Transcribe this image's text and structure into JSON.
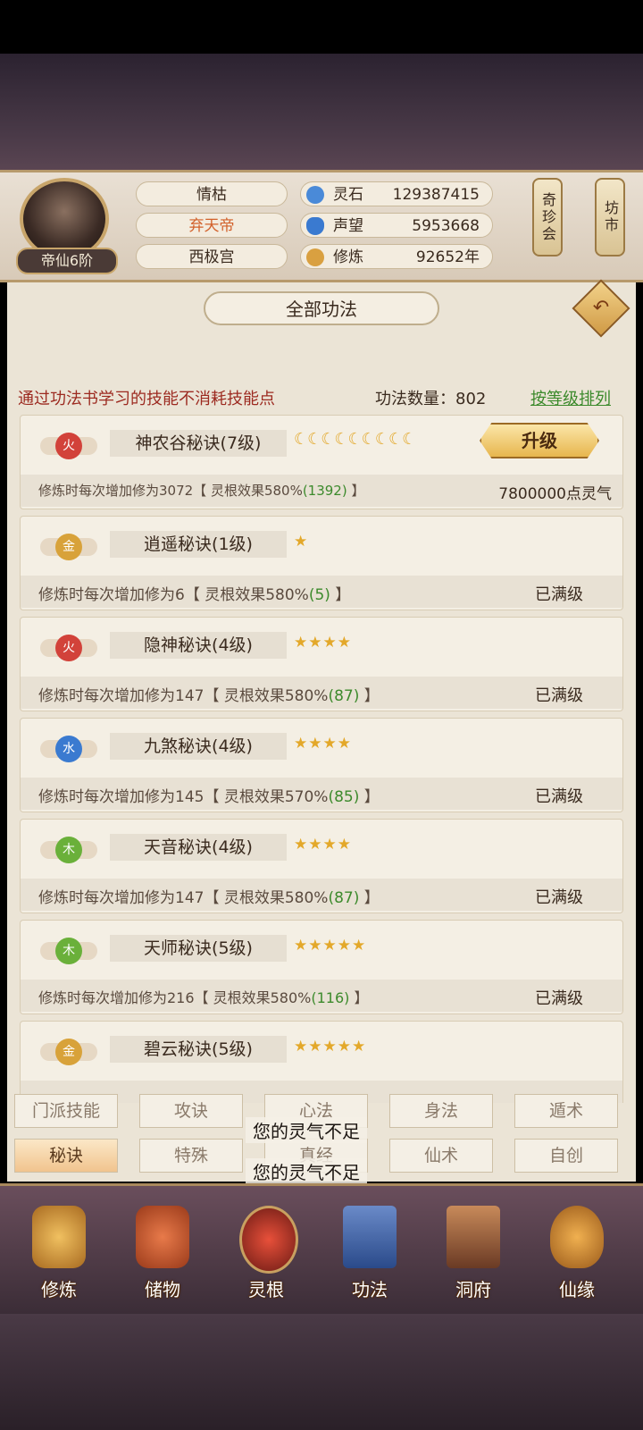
{
  "player": {
    "rank": "帝仙6阶",
    "name": "情枯",
    "title": "弃天帝",
    "sect": "西极宫",
    "resources": [
      {
        "label": "灵石",
        "value": "129387415",
        "icon": "spirit-stone-icon",
        "color": "#4a8ad8"
      },
      {
        "label": "声望",
        "value": "5953668",
        "icon": "prestige-crystal-icon",
        "color": "#3a7ad0"
      },
      {
        "label": "修炼",
        "value": "92652年",
        "icon": "meditation-icon",
        "color": "#d9a040"
      }
    ]
  },
  "side_buttons": {
    "treasure": "奇珍会",
    "market": "坊市"
  },
  "panel": {
    "title": "全部功法",
    "note": "通过功法书学习的技能不消耗技能点",
    "count_label": "功法数量：802",
    "sort_label": "按等级排列"
  },
  "skills": [
    {
      "element": "火",
      "element_color": "#d2423a",
      "name": "神农谷秘诀(7级)",
      "rating": "☾☾☾☾☾☾☾☾☾",
      "desc": "修炼时每次增加修为3072【 灵根效果580%",
      "bonus": "(1392)",
      "desc_end": " 】",
      "status": "7800000点灵气",
      "action": "升级"
    },
    {
      "element": "金",
      "element_color": "#d8a23a",
      "name": "逍遥秘诀(1级)",
      "rating": "★",
      "desc": "修炼时每次增加修为6【 灵根效果580%",
      "bonus": "(5)",
      "desc_end": " 】",
      "status": "已满级"
    },
    {
      "element": "火",
      "element_color": "#d2423a",
      "name": "隐神秘诀(4级)",
      "rating": "★★★★",
      "desc": "修炼时每次增加修为147【 灵根效果580%",
      "bonus": "(87)",
      "desc_end": " 】",
      "status": "已满级"
    },
    {
      "element": "水",
      "element_color": "#3a7ad0",
      "name": "九煞秘诀(4级)",
      "rating": "★★★★",
      "desc": "修炼时每次增加修为145【 灵根效果570%",
      "bonus": "(85)",
      "desc_end": " 】",
      "status": "已满级"
    },
    {
      "element": "木",
      "element_color": "#6ab03a",
      "name": "天音秘诀(4级)",
      "rating": "★★★★",
      "desc": "修炼时每次增加修为147【 灵根效果580%",
      "bonus": "(87)",
      "desc_end": " 】",
      "status": "已满级"
    },
    {
      "element": "木",
      "element_color": "#6ab03a",
      "name": "天师秘诀(5级)",
      "rating": "★★★★★",
      "desc": "修炼时每次增加修为216【 灵根效果580%",
      "bonus": "(116)",
      "desc_end": " 】",
      "status": "已满级"
    },
    {
      "element": "金",
      "element_color": "#d8a23a",
      "name": "碧云秘诀(5级)",
      "rating": "★★★★★",
      "desc": "",
      "bonus": "",
      "desc_end": "",
      "status": ""
    }
  ],
  "tabs_row1": [
    "门派技能",
    "攻诀",
    "心法",
    "身法",
    "遁术"
  ],
  "tabs_row2": [
    "秘诀",
    "特殊",
    "真经",
    "仙术",
    "自创"
  ],
  "active_tab": "秘诀",
  "toasts": [
    "您的灵气不足",
    "您的灵气不足"
  ],
  "bottom_nav": [
    {
      "label": "修炼",
      "icon": "cultivation-icon",
      "color": "#d8a040"
    },
    {
      "label": "储物",
      "icon": "storage-bag-icon",
      "color": "#c8502a"
    },
    {
      "label": "灵根",
      "icon": "spirit-root-icon",
      "color": "#b8322a"
    },
    {
      "label": "功法",
      "icon": "technique-book-icon",
      "color": "#3a5a9a"
    },
    {
      "label": "洞府",
      "icon": "cave-mansion-icon",
      "color": "#8a5a3a"
    },
    {
      "label": "仙缘",
      "icon": "gourd-icon",
      "color": "#c87a2a"
    }
  ]
}
